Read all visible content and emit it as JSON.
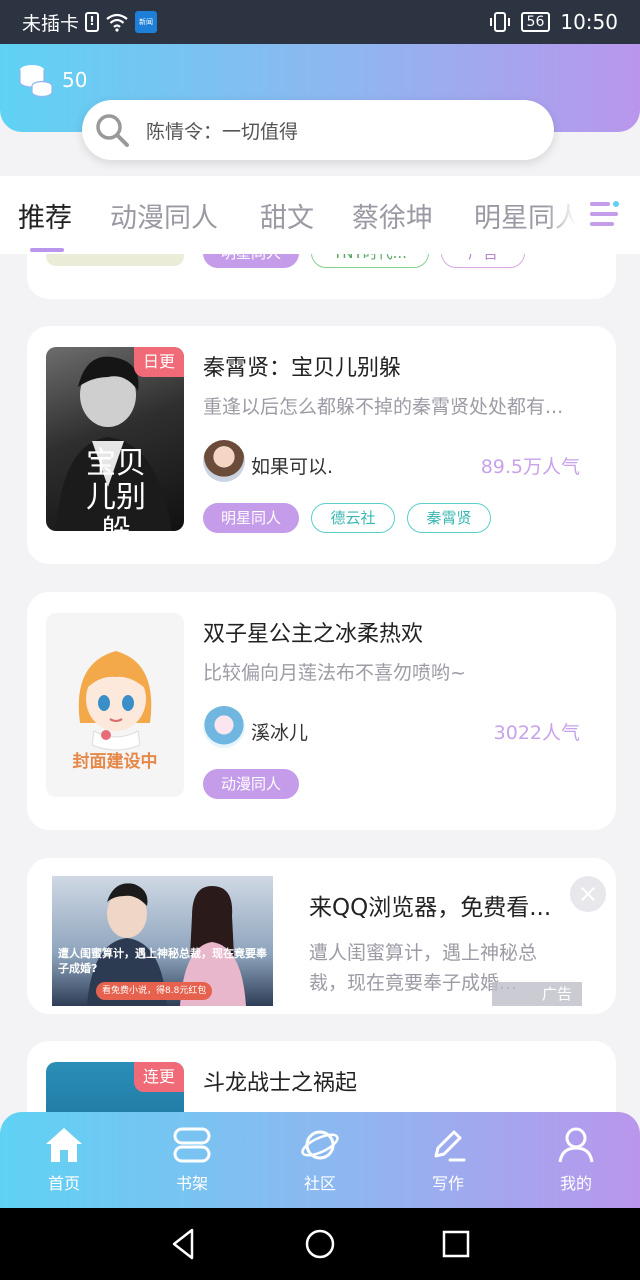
{
  "status_bar": {
    "carrier": "未插卡",
    "news_app_label": "新闻",
    "battery": "56",
    "time": "10:50"
  },
  "header": {
    "coins": "50",
    "search_placeholder": "陈情令：一切值得"
  },
  "tabs": [
    {
      "label": "推荐",
      "active": true
    },
    {
      "label": "动漫同人"
    },
    {
      "label": "甜文"
    },
    {
      "label": "蔡徐坤"
    },
    {
      "label": "明星同人"
    }
  ],
  "partial_card": {
    "tags": [
      "明星同人",
      "TNT时代...",
      "广告"
    ]
  },
  "books": [
    {
      "badge": "日更",
      "cover_text": "宝贝儿别躲",
      "title": "秦霄贤：宝贝儿别躲",
      "description": "重逢以后怎么都躲不掉的秦霄贤处处都有...",
      "author": "如果可以.",
      "popularity": "89.5万人气",
      "tags": [
        "明星同人",
        "德云社",
        "秦霄贤"
      ]
    },
    {
      "cover_text": "封面建设中",
      "title": "双子星公主之冰柔热欢",
      "description": "比较偏向月莲法布不喜勿喷哟~",
      "author": "溪冰儿",
      "popularity": "3022人气",
      "tags": [
        "动漫同人"
      ]
    },
    {
      "badge": "连更",
      "title": "斗龙战士之祸起"
    }
  ],
  "ad": {
    "title": "来QQ浏览器，免费看...",
    "description": "遭人闺蜜算计，遇上神秘总裁，现在竟要奉子成婚...",
    "label": "广告",
    "image_caption": "遭人闺蜜算计，遇上神秘总裁，现在竟要奉子成婚?",
    "image_button": "看免费小说，得8.8元红包"
  },
  "bottom_nav": [
    {
      "label": "首页",
      "icon": "home-icon"
    },
    {
      "label": "书架",
      "icon": "bookshelf-icon"
    },
    {
      "label": "社区",
      "icon": "planet-icon"
    },
    {
      "label": "写作",
      "icon": "pen-icon"
    },
    {
      "label": "我的",
      "icon": "person-icon"
    }
  ],
  "colors": {
    "gradient_start": "#5fd2f3",
    "gradient_end": "#b996ec",
    "accent_purple": "#c49ce9",
    "badge_red": "#f06b77"
  }
}
